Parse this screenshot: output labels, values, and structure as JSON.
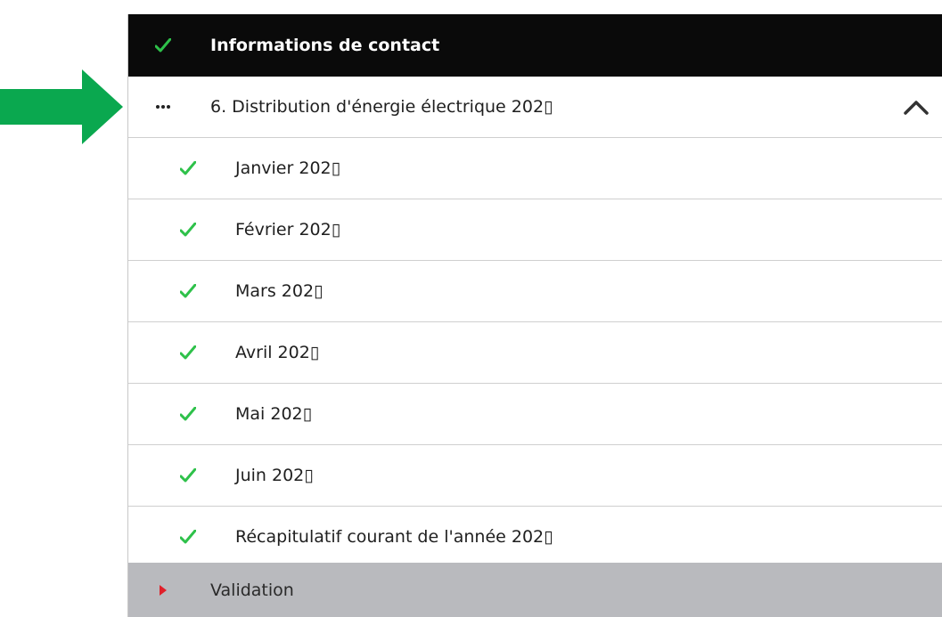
{
  "colors": {
    "accent_green": "#2ec14a",
    "arrow_green": "#0aa84f",
    "header_bg": "#0a0a0a",
    "validation_bg": "#b9babe",
    "validation_marker": "#e0202a"
  },
  "menu": {
    "header": {
      "label": "Informations de contact",
      "icon": "check-icon"
    },
    "section": {
      "label": "6. Distribution d'énergie électrique 202▯",
      "icon": "ellipsis-icon",
      "toggle_icon": "chevron-up-icon"
    },
    "sub_items": [
      {
        "label": "Janvier 202▯",
        "icon": "check-icon"
      },
      {
        "label": "Février 202▯",
        "icon": "check-icon"
      },
      {
        "label": "Mars 202▯",
        "icon": "check-icon"
      },
      {
        "label": "Avril 202▯",
        "icon": "check-icon"
      },
      {
        "label": "Mai 202▯",
        "icon": "check-icon"
      },
      {
        "label": "Juin 202▯",
        "icon": "check-icon"
      },
      {
        "label": "Récapitulatif courant de l'année 202▯",
        "icon": "check-icon"
      }
    ],
    "validation": {
      "label": "Validation",
      "icon": "caret-right-icon"
    }
  },
  "pointer": {
    "icon": "arrow-right-icon"
  }
}
